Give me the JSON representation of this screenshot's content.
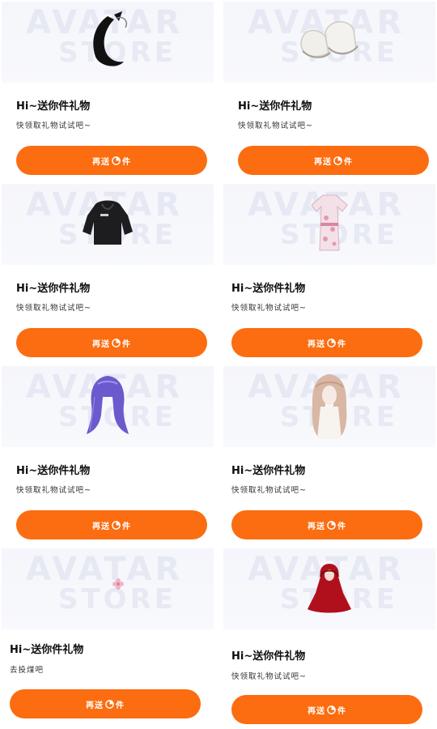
{
  "watermark": {
    "line1": "AVATAR",
    "line2": "STORE"
  },
  "cards": [
    {
      "item_icon": "fox-tail-icon",
      "title": "Hi~送你件礼物",
      "subtitle": "快领取礼物试试吧~",
      "button": "再送",
      "button_suffix": "件",
      "button_icon": "gift-icon"
    },
    {
      "item_icon": "sneakers-icon",
      "title": "Hi~送你件礼物",
      "subtitle": "快领取礼物试试吧~",
      "button": "再送",
      "button_suffix": "件",
      "button_icon": "gift-icon"
    },
    {
      "item_icon": "hoodie-icon",
      "title": "Hi~送你件礼物",
      "subtitle": "快领取礼物试试吧~",
      "button": "再送",
      "button_suffix": "件",
      "button_icon": "gift-icon"
    },
    {
      "item_icon": "kimono-icon",
      "title": "Hi~送你件礼物",
      "subtitle": "快领取礼物试试吧~",
      "button": "再送",
      "button_suffix": "件",
      "button_icon": "gift-icon"
    },
    {
      "item_icon": "purple-hair-icon",
      "title": "Hi~送你件礼物",
      "subtitle": "快领取礼物试试吧~",
      "button": "再送",
      "button_suffix": "件",
      "button_icon": "gift-icon"
    },
    {
      "item_icon": "long-hair-icon",
      "title": "Hi~送你件礼物",
      "subtitle": "快领取礼物试试吧~",
      "button": "再送",
      "button_suffix": "件",
      "button_icon": "gift-icon"
    },
    {
      "item_icon": "small-flower-icon",
      "title": "Hi~送你件礼物",
      "subtitle": "去投煤吧",
      "button": "再送",
      "button_suffix": "件",
      "button_icon": "gift-icon"
    },
    {
      "item_icon": "red-cloak-icon",
      "title": "Hi~送你件礼物",
      "subtitle": "快领取礼物试试吧~",
      "button": "再送",
      "button_suffix": "件",
      "button_icon": "gift-icon"
    }
  ]
}
